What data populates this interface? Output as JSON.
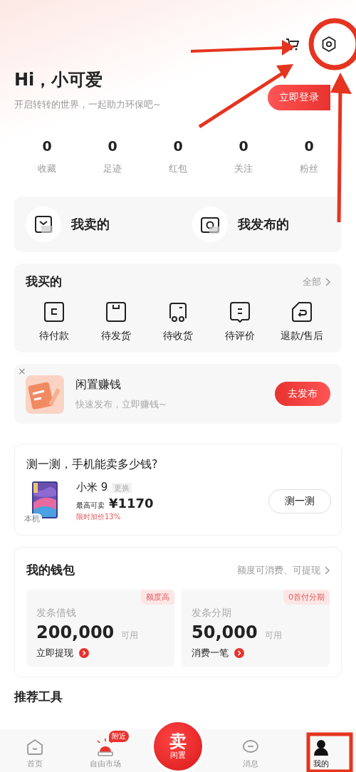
{
  "header": {
    "greeting": "Hi，小可爱",
    "subtitle": "开启转转的世界，一起助力环保吧~",
    "login_button": "立即登录"
  },
  "stats": [
    {
      "value": "0",
      "label": "收藏"
    },
    {
      "value": "0",
      "label": "足迹"
    },
    {
      "value": "0",
      "label": "红包"
    },
    {
      "value": "0",
      "label": "关注"
    },
    {
      "value": "0",
      "label": "粉丝"
    }
  ],
  "shortcuts": [
    {
      "kind": "bag",
      "label": "我卖的"
    },
    {
      "kind": "camera",
      "label": "我发布的"
    }
  ],
  "orders": {
    "title": "我买的",
    "more": "全部",
    "items": [
      {
        "kind": "pay",
        "label": "待付款"
      },
      {
        "kind": "ship",
        "label": "待发货"
      },
      {
        "kind": "truck",
        "label": "待收货"
      },
      {
        "kind": "review",
        "label": "待评价"
      },
      {
        "kind": "refund",
        "label": "退款/售后"
      }
    ]
  },
  "banner": {
    "close": "×",
    "title": "闲置赚钱",
    "subtitle": "快速发布，立即赚钱~",
    "button": "去发布"
  },
  "phone_test": {
    "title": "测一测，手机能卖多少钱?",
    "device_tag": "本机",
    "model": "小米 9",
    "change": "更换",
    "price_label": "最高可卖",
    "price": "¥1170",
    "promo": "限时加价13%",
    "button": "测一测"
  },
  "wallet": {
    "title": "我的钱包",
    "more": "额度可消费、可提现",
    "cards": [
      {
        "badge": "额度高",
        "name": "发条借钱",
        "amount": "200,000",
        "unit": "可用",
        "action": "立即提现"
      },
      {
        "badge": "0首付分期",
        "name": "发条分期",
        "amount": "50,000",
        "unit": "可用",
        "action": "消费一笔"
      }
    ]
  },
  "section_title": "推荐工具",
  "tab_bar": [
    {
      "kind": "home",
      "label": "首页",
      "selected": false
    },
    {
      "kind": "market",
      "label": "自由市场",
      "badge": "附近",
      "selected": false
    },
    {
      "kind": "sell",
      "label": "闲置",
      "icon_text": "卖",
      "selected": false
    },
    {
      "kind": "message",
      "label": "消息",
      "selected": false
    },
    {
      "kind": "me",
      "label": "我的",
      "selected": true
    }
  ]
}
